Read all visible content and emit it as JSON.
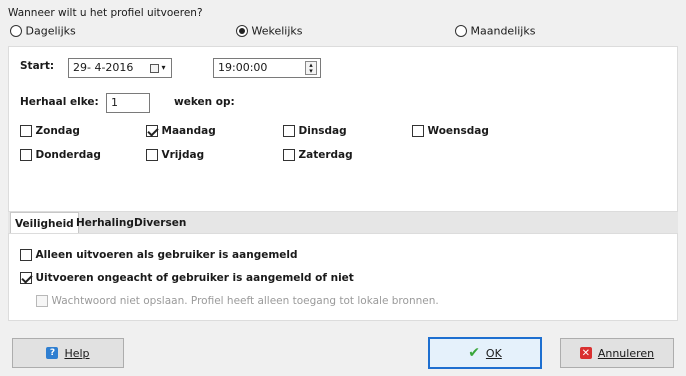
{
  "question": "Wanneer wilt u het profiel uitvoeren?",
  "frequency": {
    "options": [
      {
        "label": "Dagelijks",
        "selected": false
      },
      {
        "label": "Wekelijks",
        "selected": true
      },
      {
        "label": "Maandelijks",
        "selected": false
      }
    ]
  },
  "schedule": {
    "start_label": "Start:",
    "date_value": "29- 4-2016",
    "time_value": "19:00:00",
    "repeat_label": "Herhaal elke:",
    "repeat_value": "1",
    "weeks_on_label": "weken op:"
  },
  "days": [
    {
      "label": "Zondag",
      "checked": false
    },
    {
      "label": "Maandag",
      "checked": true
    },
    {
      "label": "Dinsdag",
      "checked": false
    },
    {
      "label": "Woensdag",
      "checked": false
    },
    {
      "label": "Donderdag",
      "checked": false
    },
    {
      "label": "Vrijdag",
      "checked": false
    },
    {
      "label": "Zaterdag",
      "checked": false
    }
  ],
  "tabs": [
    {
      "label": "Veiligheid",
      "active": true
    },
    {
      "label": "Herhaling",
      "active": false
    },
    {
      "label": "Diversen",
      "active": false
    }
  ],
  "security": {
    "only_logged_on": {
      "label": "Alleen uitvoeren als gebruiker is aangemeld",
      "checked": false
    },
    "regardless": {
      "label": "Uitvoeren ongeacht of gebruiker is aangemeld of niet",
      "checked": true
    },
    "no_password": {
      "label": "Wachtwoord niet opslaan. Profiel heeft alleen toegang tot lokale bronnen.",
      "checked": false,
      "disabled": true
    }
  },
  "buttons": {
    "help_label": "Help",
    "ok_label": "OK",
    "cancel_label": "Annuleren"
  },
  "colors": {
    "accent": "#1e6fd0",
    "ok_check": "#3aa63a",
    "cancel_red": "#d93030"
  }
}
